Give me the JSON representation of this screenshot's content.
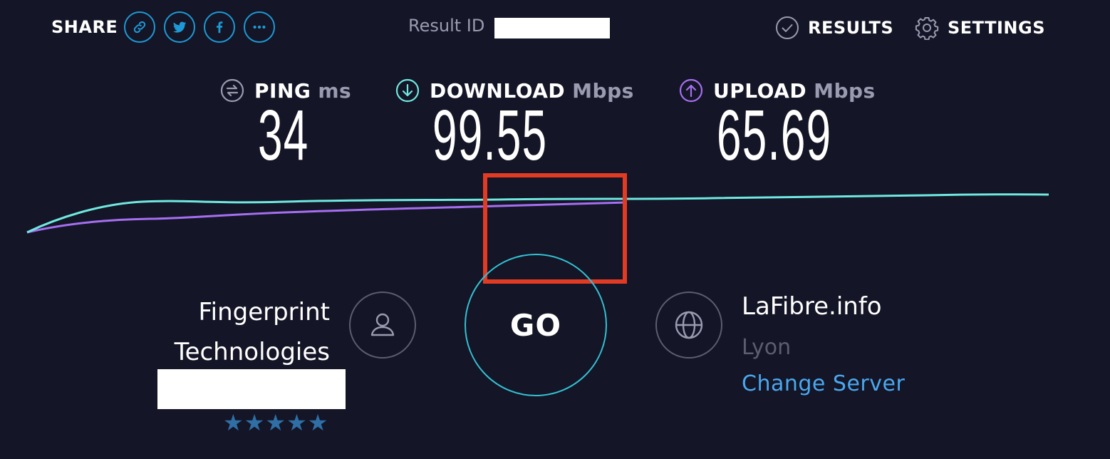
{
  "header": {
    "share_label": "SHARE",
    "share_icons": [
      "link-icon",
      "twitter-icon",
      "facebook-icon",
      "more-icon"
    ],
    "result_label": "Result ID",
    "results_label": "RESULTS",
    "settings_label": "SETTINGS"
  },
  "metrics": {
    "ping": {
      "label": "PING",
      "unit": "ms",
      "value": "34"
    },
    "download": {
      "label": "DOWNLOAD",
      "unit": "Mbps",
      "value": "99.55"
    },
    "upload": {
      "label": "UPLOAD",
      "unit": "Mbps",
      "value": "65.69"
    }
  },
  "isp": {
    "name_line1": "Fingerprint",
    "name_line2": "Technologies",
    "rating": 5
  },
  "go_label": "GO",
  "server": {
    "name": "LaFibre.info",
    "location": "Lyon",
    "change_label": "Change Server"
  },
  "colors": {
    "background": "#141526",
    "download": "#6fe8e0",
    "upload": "#a56ff0",
    "link": "#4aa8f0",
    "highlight": "#e23b24"
  }
}
